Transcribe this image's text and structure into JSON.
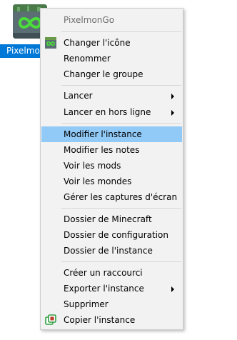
{
  "instance": {
    "label": "Pixelmon",
    "icon": "pixelmon-infinity-icon"
  },
  "menu": {
    "header": "PixelmonGo",
    "change_icon": "Changer l'icône",
    "rename": "Renommer",
    "change_group": "Changer le groupe",
    "launch": "Lancer",
    "launch_offline": "Lancer en hors ligne",
    "edit_instance": "Modifier l'instance",
    "edit_notes": "Modifier les notes",
    "view_mods": "Voir les mods",
    "view_worlds": "Voir les mondes",
    "manage_screenshots": "Gérer les captures d'écran",
    "minecraft_folder": "Dossier de Minecraft",
    "config_folder": "Dossier de configuration",
    "instance_folder": "Dossier de l'instance",
    "create_shortcut": "Créer un raccourci",
    "export_instance": "Exporter l'instance",
    "delete": "Supprimer",
    "copy_instance": "Copier l'instance"
  },
  "colors": {
    "selection": "#0078d7",
    "menu_highlight": "#91c9f7",
    "menu_background": "#f2f2f2"
  }
}
